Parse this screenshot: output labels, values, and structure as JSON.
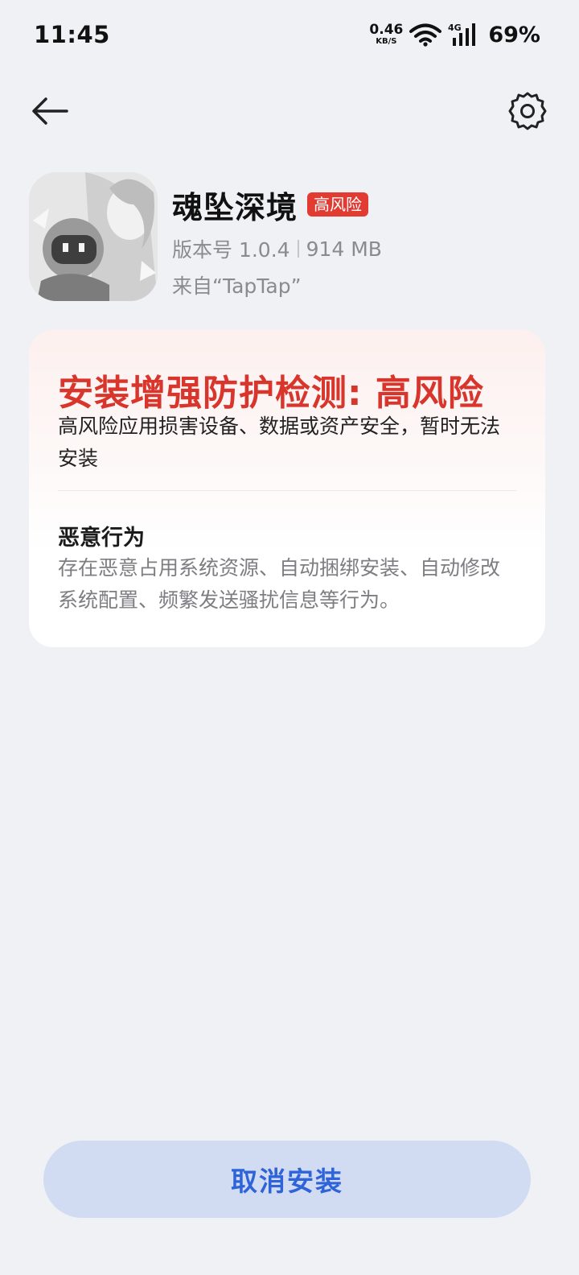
{
  "status_bar": {
    "time": "11:45",
    "net_speed_value": "0.46",
    "net_speed_unit": "KB/S",
    "network_type": "4G",
    "battery": "69%"
  },
  "nav": {
    "back_icon": "arrow-left-icon",
    "settings_icon": "gear-icon"
  },
  "app": {
    "name": "魂坠深境",
    "risk_badge": "高风险",
    "version": "版本号 1.0.4",
    "size": "914 MB",
    "source": "来自“TapTap”"
  },
  "risk_card": {
    "title": "安装增强防护检测: 高风险",
    "description": "高风险应用损害设备、数据或资产安全，暂时无法安装",
    "behavior_title": "恶意行为",
    "behavior_description": "存在恶意占用系统资源、自动捆绑安装、自动修改系统配置、频繁发送骚扰信息等行为。"
  },
  "actions": {
    "cancel_label": "取消安装"
  },
  "colors": {
    "background": "#f0f1f4",
    "risk_red": "#d8362c",
    "badge_red": "#e23b32",
    "button_bg": "#d1dcf3",
    "button_text": "#2f63d8"
  }
}
